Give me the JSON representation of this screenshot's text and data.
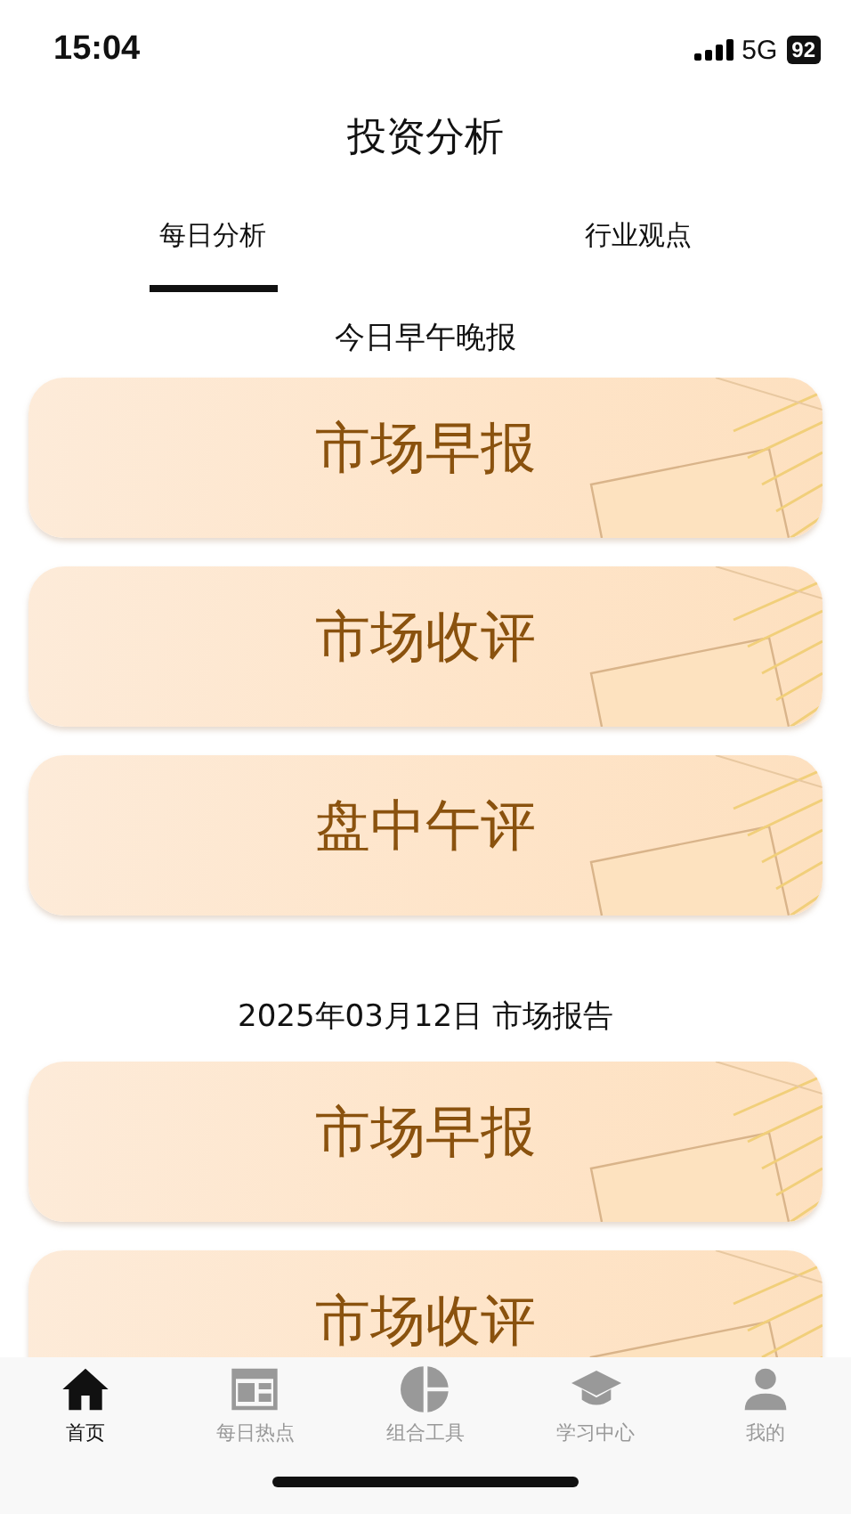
{
  "status_bar": {
    "time": "15:04",
    "network": "5G",
    "battery": "92"
  },
  "title": "投资分析",
  "tabs": [
    {
      "label": "每日分析",
      "selected": true
    },
    {
      "label": "行业观点",
      "selected": false
    }
  ],
  "sections": [
    {
      "heading": "今日早午晚报",
      "cards": [
        {
          "label": "市场早报"
        },
        {
          "label": "市场收评"
        },
        {
          "label": "盘中午评"
        }
      ]
    },
    {
      "heading": "2025年03月12日 市场报告",
      "cards": [
        {
          "label": "市场早报"
        },
        {
          "label": "市场收评"
        }
      ]
    }
  ],
  "nav": [
    {
      "label": "首页",
      "kind": "home",
      "selected": true
    },
    {
      "label": "每日热点",
      "kind": "news",
      "selected": false
    },
    {
      "label": "组合工具",
      "kind": "pie",
      "selected": false
    },
    {
      "label": "学习中心",
      "kind": "cap",
      "selected": false
    },
    {
      "label": "我的",
      "kind": "person",
      "selected": false
    }
  ]
}
